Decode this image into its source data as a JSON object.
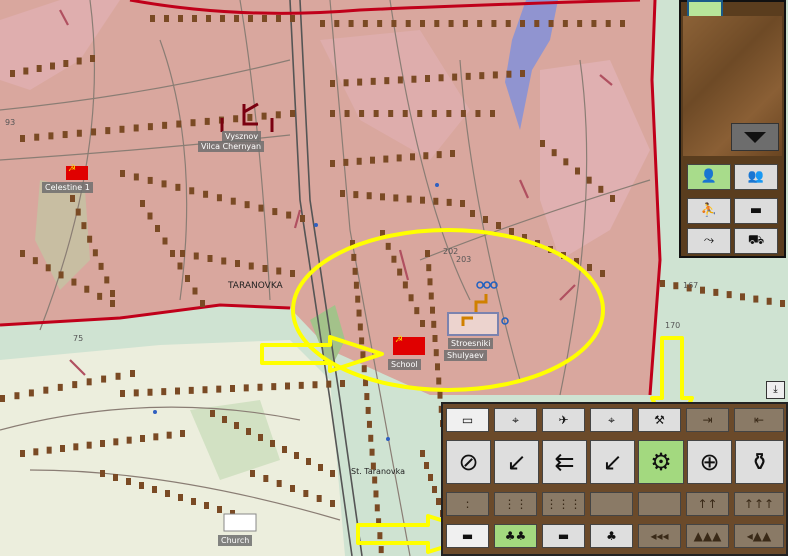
{
  "map": {
    "places": {
      "vysznov": "Vysznov",
      "vilca": "Vilca Chernyan",
      "celestine": "Celestine 1",
      "taranovka": "TARANOVKA",
      "school": "School",
      "stroesniki": "Stroesniki",
      "shulyaev": "Shulyaev",
      "st_taranovka": "St. Taranovka",
      "church": "Church"
    },
    "elevations": [
      "167",
      "170",
      "202",
      "203",
      "75",
      "93"
    ]
  },
  "side_panel": {
    "buttons": [
      "single-soldier",
      "squad",
      "infantry-group",
      "tank",
      "crawling-soldier",
      "truck"
    ],
    "selected": "single-soldier"
  },
  "orders_panel": {
    "top_row": [
      "ammo",
      "target-infantry",
      "target-aircraft",
      "target-vehicle",
      "shovel",
      "enter",
      "exit"
    ],
    "main_row": [
      "stop",
      "retreat",
      "fast-move",
      "sneak",
      "deploy-gear",
      "attack-target",
      "shell"
    ],
    "main_row_active": "deploy-gear",
    "formation_row": [
      ":",
      "⋮⋮",
      "⋮⋮⋮",
      "",
      "",
      "↑↑",
      "↑↑↑"
    ],
    "bottom_row": [
      "list",
      "forest-selected",
      "tank-group",
      "forest-group",
      "◂◂◂",
      "▲▲▲",
      "◂▲▲"
    ],
    "bottom_row_active": "forest-selected"
  },
  "colors": {
    "friendly_area": "#d9a79e",
    "neutral_area": "#cfe3d2",
    "border_line": "#c0001a",
    "highlight_yellow": "#ffff00",
    "button_green": "#a3d97f",
    "buildings": "#7a4a24"
  }
}
